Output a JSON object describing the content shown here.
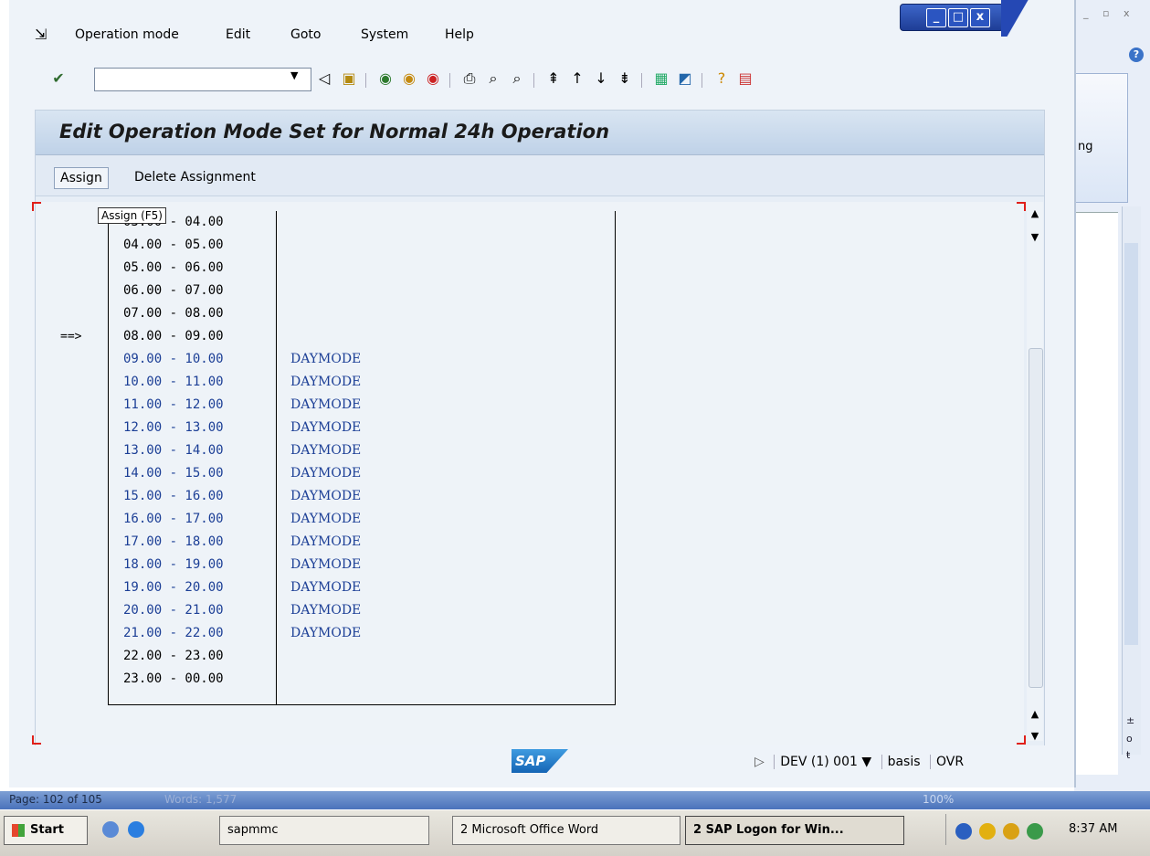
{
  "window": {
    "menu": [
      "Operation mode",
      "Edit",
      "Goto",
      "System",
      "Help"
    ],
    "title": "Edit Operation Mode Set for Normal 24h Operation"
  },
  "app_toolbar": {
    "assign_label": "Assign",
    "delete_label": "Delete Assignment",
    "tooltip": "Assign   (F5)"
  },
  "schedule": {
    "current_marker": "==>",
    "current_row_index": 4,
    "rows": [
      {
        "time": "03.00 - 04.00",
        "mode": ""
      },
      {
        "time": "04.00 - 05.00",
        "mode": ""
      },
      {
        "time": "05.00 - 06.00",
        "mode": ""
      },
      {
        "time": "06.00 - 07.00",
        "mode": ""
      },
      {
        "time": "07.00 - 08.00",
        "mode": ""
      },
      {
        "time": "08.00 - 09.00",
        "mode": ""
      },
      {
        "time": "09.00 - 10.00",
        "mode": "DAYMODE"
      },
      {
        "time": "10.00 - 11.00",
        "mode": "DAYMODE"
      },
      {
        "time": "11.00 - 12.00",
        "mode": "DAYMODE"
      },
      {
        "time": "12.00 - 13.00",
        "mode": "DAYMODE"
      },
      {
        "time": "13.00 - 14.00",
        "mode": "DAYMODE"
      },
      {
        "time": "14.00 - 15.00",
        "mode": "DAYMODE"
      },
      {
        "time": "15.00 - 16.00",
        "mode": "DAYMODE"
      },
      {
        "time": "16.00 - 17.00",
        "mode": "DAYMODE"
      },
      {
        "time": "17.00 - 18.00",
        "mode": "DAYMODE"
      },
      {
        "time": "18.00 - 19.00",
        "mode": "DAYMODE"
      },
      {
        "time": "19.00 - 20.00",
        "mode": "DAYMODE"
      },
      {
        "time": "20.00 - 21.00",
        "mode": "DAYMODE"
      },
      {
        "time": "21.00 - 22.00",
        "mode": "DAYMODE"
      },
      {
        "time": "22.00 - 23.00",
        "mode": ""
      },
      {
        "time": "23.00 - 00.00",
        "mode": ""
      }
    ]
  },
  "status": {
    "logo": "SAP",
    "system": "DEV (1) 001",
    "user": "basis",
    "mode": "OVR"
  },
  "word": {
    "page": "Page: 102 of 105",
    "words": "Words: 1,577",
    "zoom": "100%",
    "ribbon_fragment": "ng"
  },
  "taskbar": {
    "start": "Start",
    "items": [
      "sapmmc",
      "2 Microsoft Office Word",
      "2 SAP Logon for Win..."
    ],
    "clock": "8:37 AM"
  },
  "colors": {
    "accent": "#1c3f96",
    "titlebar": "#bfd2e8"
  }
}
